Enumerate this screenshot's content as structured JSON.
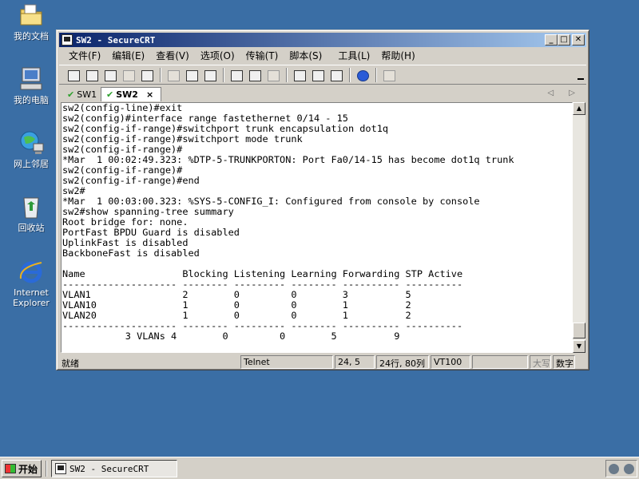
{
  "desktop": {
    "icons": [
      {
        "label": "我的文档",
        "icon": "my-documents-icon"
      },
      {
        "label": "我的电脑",
        "icon": "my-computer-icon"
      },
      {
        "label": "网上邻居",
        "icon": "network-places-icon"
      },
      {
        "label": "回收站",
        "icon": "recycle-bin-icon"
      },
      {
        "label": "Internet Explorer",
        "icon": "internet-explorer-icon"
      }
    ]
  },
  "window": {
    "title": "SW2 - SecureCRT",
    "buttons": {
      "minimize": "_",
      "maximize": "□",
      "close": "✕"
    },
    "menu": [
      "文件(F)",
      "编辑(E)",
      "查看(V)",
      "选项(O)",
      "传输(T)",
      "脚本(S)",
      "工具(L)",
      "帮助(H)"
    ],
    "tabs": [
      {
        "label": "SW1",
        "active": false
      },
      {
        "label": "SW2",
        "active": true,
        "close": "×"
      }
    ],
    "tab_nav": "◁ ▷",
    "terminal_lines": [
      "sw2(config-line)#exit",
      "sw2(config)#interface range fastethernet 0/14 - 15",
      "sw2(config-if-range)#switchport trunk encapsulation dot1q",
      "sw2(config-if-range)#switchport mode trunk",
      "sw2(config-if-range)#",
      "*Mar  1 00:02:49.323: %DTP-5-TRUNKPORTON: Port Fa0/14-15 has become dot1q trunk",
      "sw2(config-if-range)#",
      "sw2(config-if-range)#end",
      "sw2#",
      "*Mar  1 00:03:00.323: %SYS-5-CONFIG_I: Configured from console by console",
      "sw2#show spanning-tree summary",
      "Root bridge for: none.",
      "PortFast BPDU Guard is disabled",
      "UplinkFast is disabled",
      "BackboneFast is disabled",
      "",
      "Name                 Blocking Listening Learning Forwarding STP Active",
      "-------------------- -------- --------- -------- ---------- ----------",
      "VLAN1                2        0         0        3          5",
      "VLAN10               1        0         0        1          2",
      "VLAN20               1        0         0        1          2",
      "-------------------- -------- --------- -------- ---------- ----------",
      "           3 VLANs 4        0         0        5          9"
    ],
    "prompt": "sw2#",
    "status": {
      "ready": "就绪",
      "protocol": "Telnet",
      "position": "24,  5",
      "size": "24行, 80列",
      "emulation": "VT100",
      "caps": "大写",
      "num": "数字"
    }
  },
  "taskbar": {
    "start_label": "开始",
    "task_label": "SW2 - SecureCRT"
  }
}
